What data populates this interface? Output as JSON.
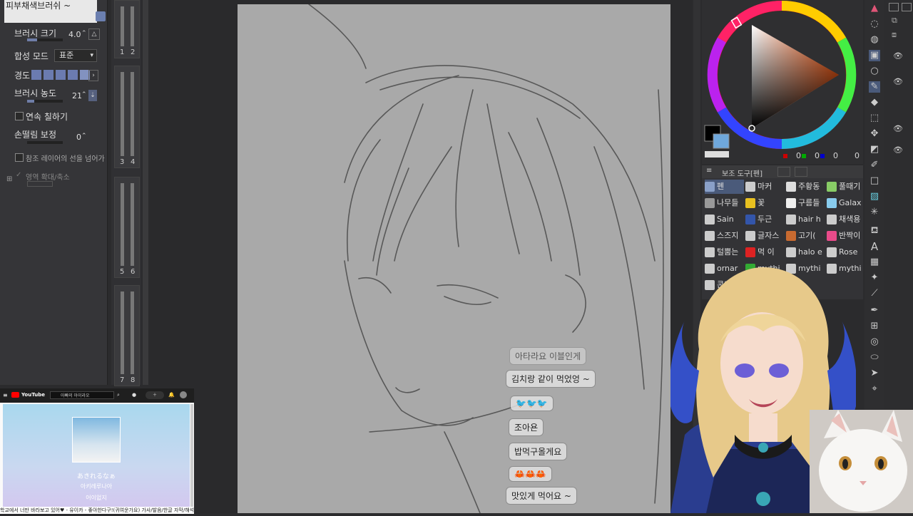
{
  "tool_property": {
    "title": "피부채색브러쉬 ~",
    "brush_size_label": "브러시 크기",
    "brush_size_value": "4.0",
    "blend_mode_label": "합성 모드",
    "blend_mode_value": "표준",
    "hardness_label": "경도",
    "brush_density_label": "브러시 농도",
    "brush_density_value": "21",
    "continuous_paint_label": "연속 칠하기",
    "stabilization_label": "손떨림 보정",
    "stabilization_value": "0",
    "ref_layer_label": "참조 레이어의 선을 넘어가",
    "area_scale_label": "영역 확대/축소"
  },
  "brush_size_strip": {
    "numbers": [
      "1",
      "2",
      "3",
      "4",
      "5",
      "6",
      "7",
      "8"
    ]
  },
  "color_panel": {
    "rgb_values": [
      "0",
      "0",
      "0",
      "0"
    ],
    "colors": {
      "main": "#000000",
      "sub": "#6fa8dc"
    }
  },
  "sub_tool": {
    "header_label": "보조 도구[펜]",
    "items": [
      {
        "label": "펜",
        "icon": "pen-icon",
        "color": "#8aa0c8",
        "selected": true
      },
      {
        "label": "마커",
        "icon": "marker-icon",
        "color": "#cccccc"
      },
      {
        "label": "주황동",
        "icon": "sparkle-icon",
        "color": "#dddddd"
      },
      {
        "label": "풀때기",
        "icon": "grass-icon",
        "color": "#88cc66"
      },
      {
        "label": "나무들",
        "icon": "tree-icon",
        "color": "#999999"
      },
      {
        "label": "꽃",
        "icon": "flower-icon",
        "color": "#e8c020"
      },
      {
        "label": "구름들",
        "icon": "cloud-icon",
        "color": "#eeeeee"
      },
      {
        "label": "Galax",
        "icon": "galaxy-icon",
        "color": "#88ccee"
      },
      {
        "label": "Sain",
        "icon": "brush-icon",
        "color": "#cccccc"
      },
      {
        "label": "두근",
        "icon": "heart-pattern-icon",
        "color": "#3355aa"
      },
      {
        "label": "hair h",
        "icon": "hair-icon",
        "color": "#cccccc"
      },
      {
        "label": "채색용",
        "icon": "color-brush-icon",
        "color": "#cccccc"
      },
      {
        "label": "스즈지",
        "icon": "pen-nib-icon",
        "color": "#cccccc"
      },
      {
        "label": "글자스",
        "icon": "letter-icon",
        "color": "#cccccc"
      },
      {
        "label": "고기(",
        "icon": "meat-icon",
        "color": "#c86a30"
      },
      {
        "label": "반짝이",
        "icon": "glitter-icon",
        "color": "#e94b8a"
      },
      {
        "label": "털뿜는",
        "icon": "fur-icon",
        "color": "#cccccc"
      },
      {
        "label": "먹 이",
        "icon": "ink-icon",
        "color": "#dd2222"
      },
      {
        "label": "halo e",
        "icon": "halo-icon",
        "color": "#cccccc"
      },
      {
        "label": "Rose",
        "icon": "rose-icon",
        "color": "#cccccc"
      },
      {
        "label": "ornar",
        "icon": "ornament-icon",
        "color": "#cccccc"
      },
      {
        "label": "mythi",
        "icon": "leaf-icon",
        "color": "#33aa33"
      },
      {
        "label": "mythi",
        "icon": "myth-icon",
        "color": "#cccccc"
      },
      {
        "label": "mythi",
        "icon": "myth2-icon",
        "color": "#cccccc"
      },
      {
        "label": "콘티 3",
        "icon": "storyboard-icon",
        "color": "#cccccc"
      }
    ]
  },
  "youtube": {
    "logo": "YouTube",
    "search_text": "아빠의 아이라오",
    "song_title": "あきれるなぁ",
    "song_subtitle": "아키레루나아",
    "song_line3": "어이없지",
    "caption": "학교에서 너만 바라보고 있어♥ - 유이카 - 좋아한다구!(귀여운가요) 가사/발음/한글 자막/해석"
  },
  "chat": {
    "messages": [
      {
        "text": "아타라요 이블인게"
      },
      {
        "text": "김치랑 같이 먹었엉 ~"
      },
      {
        "text": "🐦🐦🐦"
      },
      {
        "text": "조아욘"
      },
      {
        "text": "밥먹구올게요"
      },
      {
        "text": "🦀🦀🦀"
      },
      {
        "text": "맛있게 먹어요 ~"
      }
    ]
  },
  "colors": {
    "accent": "#6b7fb0",
    "panel": "#353538"
  }
}
